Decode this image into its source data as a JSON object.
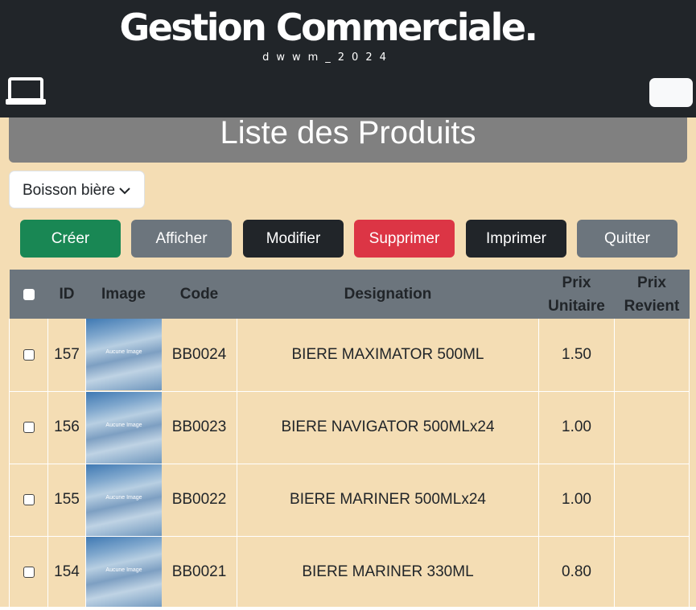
{
  "header": {
    "title": "Gestion Commerciale.",
    "subtitle": "dwwm_2024",
    "logo_icon": "laptop-icon",
    "toggler_icon": "menu-toggler"
  },
  "banner": {
    "title": "Liste des Produits"
  },
  "filter": {
    "selected": "Boisson bière"
  },
  "toolbar": {
    "create": "Créer",
    "show": "Afficher",
    "edit": "Modifier",
    "delete": "Supprimer",
    "print": "Imprimer",
    "quit": "Quitter"
  },
  "table": {
    "columns": {
      "id": "ID",
      "image": "Image",
      "code": "Code",
      "designation": "Designation",
      "prix_unitaire_1": "Prix",
      "prix_unitaire_2": "Unitaire",
      "prix_revient_1": "Prix",
      "prix_revient_2": "Revient"
    },
    "rows": [
      {
        "id": "157",
        "image_text": "Aucune Image",
        "code": "BB0024",
        "designation": "BIERE MAXIMATOR 500ML",
        "prix_unitaire": "1.50",
        "prix_revient": ""
      },
      {
        "id": "156",
        "image_text": "Aucune Image",
        "code": "BB0023",
        "designation": "BIERE NAVIGATOR 500MLx24",
        "prix_unitaire": "1.00",
        "prix_revient": ""
      },
      {
        "id": "155",
        "image_text": "Aucune Image",
        "code": "BB0022",
        "designation": "BIERE MARINER 500MLx24",
        "prix_unitaire": "1.00",
        "prix_revient": ""
      },
      {
        "id": "154",
        "image_text": "Aucune Image",
        "code": "BB0021",
        "designation": "BIERE MARINER 330ML",
        "prix_unitaire": "0.80",
        "prix_revient": ""
      }
    ]
  },
  "colors": {
    "page_bg": "#f4ddb4",
    "navbar": "#212529",
    "banner": "#808080",
    "success": "#198754",
    "secondary": "#6c757d",
    "danger": "#dc3545",
    "dark": "#212529"
  }
}
